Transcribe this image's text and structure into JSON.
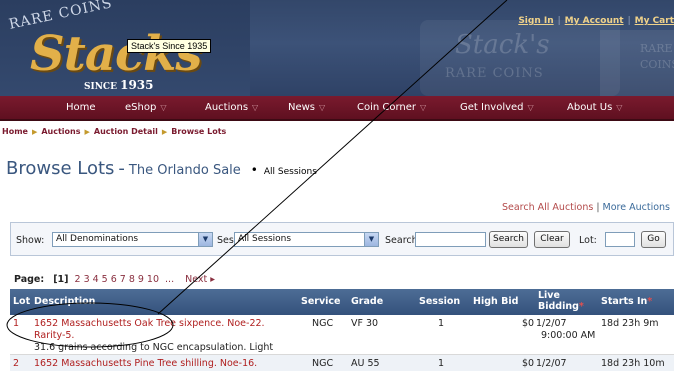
{
  "header": {
    "logo_arc": "RARE COINS",
    "logo_main": "Stacks",
    "logo_since": "SINCE",
    "logo_year": "1935",
    "tooltip": "Stack's Since 1935",
    "bg_text_1": "Stack's",
    "bg_text_2": "RARE COINS",
    "bg_text_3": "RARE",
    "bg_text_4": "COINS",
    "links": {
      "sign_in": "Sign In",
      "my_account": "My Account",
      "my_cart": "My Cart",
      "sep": "|"
    }
  },
  "nav": {
    "items": [
      {
        "label": "Home",
        "chev": ""
      },
      {
        "label": "eShop",
        "chev": "▽"
      },
      {
        "label": "Auctions",
        "chev": "▽"
      },
      {
        "label": "News",
        "chev": "▽"
      },
      {
        "label": "Coin Corner",
        "chev": "▽"
      },
      {
        "label": "Get Involved",
        "chev": "▽"
      },
      {
        "label": "About Us",
        "chev": "▽"
      }
    ]
  },
  "breadcrumb": {
    "items": [
      "Home",
      "Auctions",
      "Auction Detail",
      "Browse Lots"
    ],
    "sep": "▶"
  },
  "title": {
    "main": "Browse Lots",
    "dash": "-",
    "sale": "The Orlando Sale",
    "bullet": "•",
    "session": "All Sessions"
  },
  "search_links": {
    "search_all": "Search All Auctions",
    "sep": "|",
    "more": "More Auctions"
  },
  "filter": {
    "show_label": "Show:",
    "show_value": "All Denominations",
    "session_label": "Session:",
    "session_value": "All Sessions",
    "search_label": "Search:",
    "search_button": "Search",
    "clear_button": "Clear",
    "lot_label": "Lot:",
    "go_button": "Go",
    "dropdown_arrow": "▼"
  },
  "pager": {
    "label": "Page:",
    "current": "[1]",
    "pages": [
      "2",
      "3",
      "4",
      "5",
      "6",
      "7",
      "8",
      "9",
      "10"
    ],
    "ellipsis": "...",
    "next": "Next ▸"
  },
  "table": {
    "headers": {
      "lot": "Lot",
      "description": "Description",
      "service": "Service",
      "grade": "Grade",
      "session": "Session",
      "high_bid": "High Bid",
      "live_bidding": "Live Bidding",
      "starts_in": "Starts In",
      "req": "*"
    },
    "rows": [
      {
        "lot": "1",
        "desc_line1": "1652 Massachusetts Oak Tree sixpence. Noe-22.",
        "desc_line2": "Rarity-5.",
        "desc_line3": "31.6 grains according to NGC encapsulation. Light",
        "service": "NGC",
        "grade": "VF 30",
        "session": "1",
        "high_bid": "$0",
        "live_date": "1/2/07",
        "live_time": "9:00:00 AM",
        "starts_in": "18d 23h 9m"
      },
      {
        "lot": "2",
        "desc_line1": "1652 Massachusetts Pine Tree shilling. Noe-16.",
        "service": "NGC",
        "grade": "AU 55",
        "session": "1",
        "high_bid": "$0",
        "live_date": "1/2/07",
        "starts_in": "18d 23h 10m"
      }
    ]
  },
  "colors": {
    "nav_bg": "#6b1526",
    "header_bg": "#3a5078",
    "title_blue": "#3a577f",
    "link_red": "#b02020",
    "logo_gold": "#e2b049"
  }
}
